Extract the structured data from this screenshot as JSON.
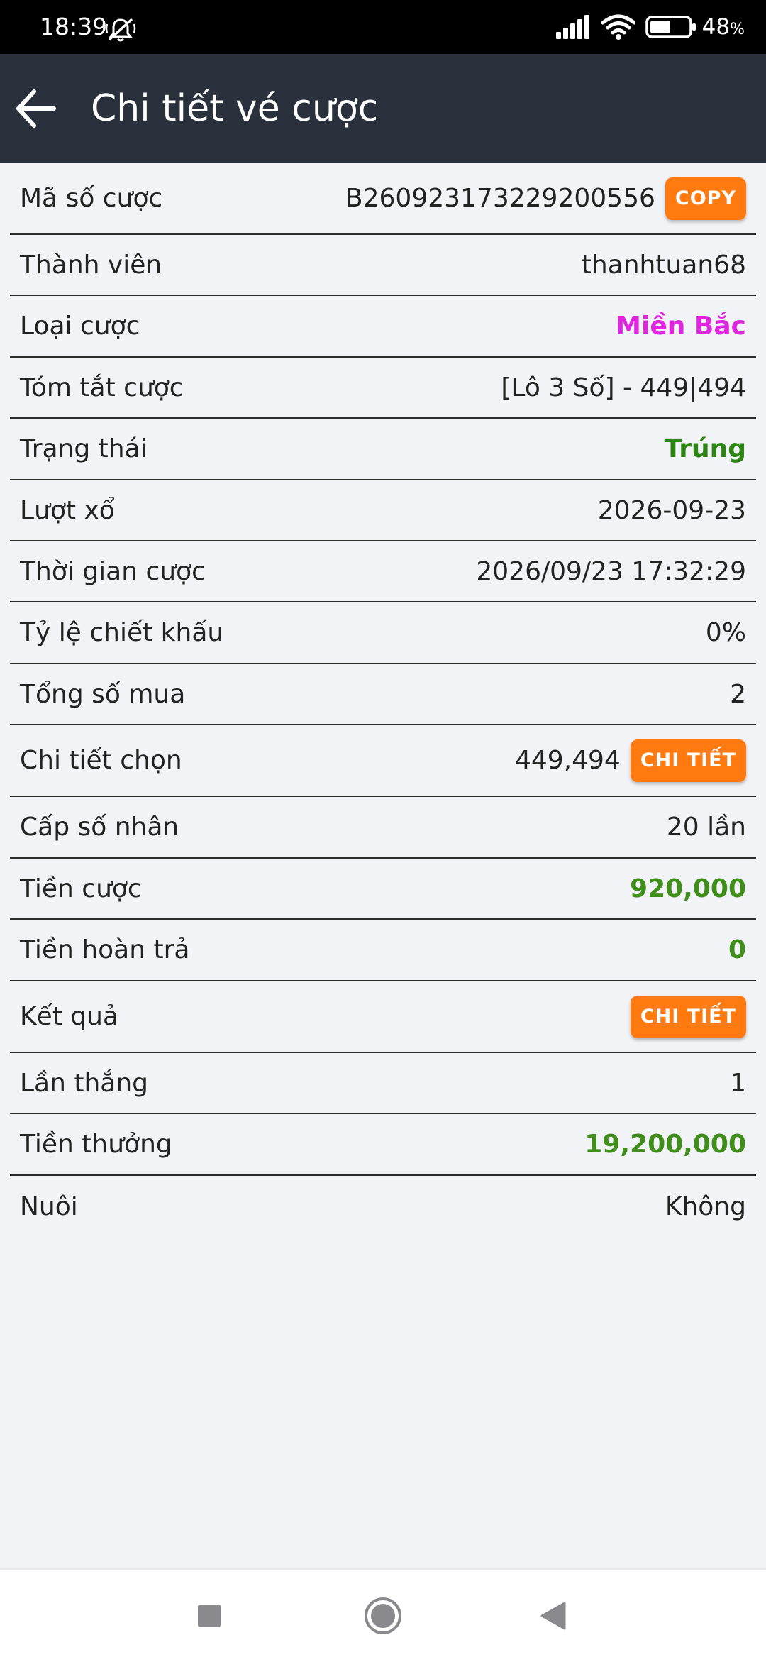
{
  "status_bar": {
    "time": "18:39",
    "battery_percent": "48",
    "battery_unit": "%",
    "battery_level": 0.48
  },
  "app_bar": {
    "title": "Chi tiết vé cược"
  },
  "details": {
    "bet_code": {
      "label": "Mã số cược",
      "value": "B260923173229200556",
      "button": "COPY"
    },
    "member": {
      "label": "Thành viên",
      "value": "thanhtuan68"
    },
    "bet_type": {
      "label": "Loại cược",
      "value": "Miền Bắc",
      "color": "#e025df"
    },
    "bet_summary": {
      "label": "Tóm tắt cược",
      "value": "[Lô 3 Số] - 449|494"
    },
    "status": {
      "label": "Trạng thái",
      "value": "Trúng",
      "color": "#2d8613"
    },
    "draw": {
      "label": "Lượt xổ",
      "value": "2026-09-23"
    },
    "bet_time": {
      "label": "Thời gian cược",
      "value": "2026/09/23 17:32:29"
    },
    "discount_rate": {
      "label": "Tỷ lệ chiết khấu",
      "value": "0%"
    },
    "total_bought": {
      "label": "Tổng số mua",
      "value": "2"
    },
    "selection_detail": {
      "label": "Chi tiết chọn",
      "value": "449,494",
      "button": "CHI TIẾT"
    },
    "multiplier": {
      "label": "Cấp số nhân",
      "value": "20 lần"
    },
    "bet_amount": {
      "label": "Tiền cược",
      "value": "920,000",
      "color": "#3f8e1a"
    },
    "refund": {
      "label": "Tiền hoàn trả",
      "value": "0",
      "color": "#3f8e1a"
    },
    "result": {
      "label": "Kết quả",
      "button": "CHI TIẾT"
    },
    "wins": {
      "label": "Lần thắng",
      "value": "1"
    },
    "prize": {
      "label": "Tiền thưởng",
      "value": "19,200,000",
      "color": "#3f8e1a"
    },
    "nurture": {
      "label": "Nuôi",
      "value": "Không"
    }
  },
  "colors": {
    "app_bar_bg": "#2b313c",
    "accent_button": "#ff7a10",
    "background": "#f2f3f7"
  },
  "icons": {
    "back": "arrow-left-icon",
    "nav_recents": "square-icon",
    "nav_home": "circle-icon",
    "nav_back": "triangle-back-icon"
  }
}
